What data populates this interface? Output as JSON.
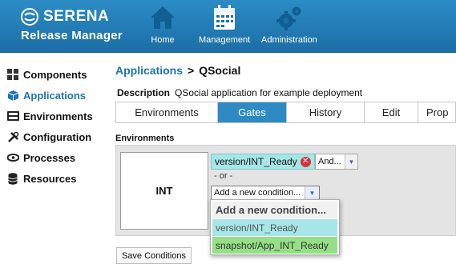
{
  "brand": {
    "name": "SERENA",
    "product": "Release Manager"
  },
  "topnav": [
    {
      "label": "Home",
      "icon": "home-icon"
    },
    {
      "label": "Management",
      "icon": "calendar-icon"
    },
    {
      "label": "Administration",
      "icon": "gears-icon"
    }
  ],
  "sidebar": {
    "items": [
      {
        "label": "Components",
        "icon": "components-icon",
        "active": false
      },
      {
        "label": "Applications",
        "icon": "cube-icon",
        "active": true
      },
      {
        "label": "Environments",
        "icon": "environments-icon",
        "active": false
      },
      {
        "label": "Configuration",
        "icon": "tools-icon",
        "active": false
      },
      {
        "label": "Processes",
        "icon": "processes-icon",
        "active": false
      },
      {
        "label": "Resources",
        "icon": "database-icon",
        "active": false
      }
    ]
  },
  "breadcrumb": {
    "parent": "Applications",
    "separator": ">",
    "current": "QSocial"
  },
  "description": {
    "label": "Description",
    "value": "QSocial application for example deployment"
  },
  "tabs": [
    {
      "label": "Environments",
      "active": false
    },
    {
      "label": "Gates",
      "active": true
    },
    {
      "label": "History",
      "active": false
    },
    {
      "label": "Edit",
      "active": false
    },
    {
      "label": "Prop",
      "active": false
    }
  ],
  "environments_section": {
    "title": "Environments",
    "environment_name": "INT",
    "condition_tag": "version/INT_Ready",
    "operator_value": "And...",
    "or_text": "- or -",
    "add_condition_value": "Add a new condition...",
    "dropdown_options": [
      {
        "label": "Add a new condition...",
        "style": "header"
      },
      {
        "label": "version/INT_Ready",
        "style": "teal"
      },
      {
        "label": "snapshot/App_INT_Ready",
        "style": "green"
      }
    ]
  },
  "save_button": "Save Conditions",
  "colors": {
    "header": "#2582bf",
    "accent": "#1e73b5",
    "tab_active": "#2e8ac3",
    "version_tag": "#a6e6e6",
    "snapshot_tag": "#95df86"
  }
}
